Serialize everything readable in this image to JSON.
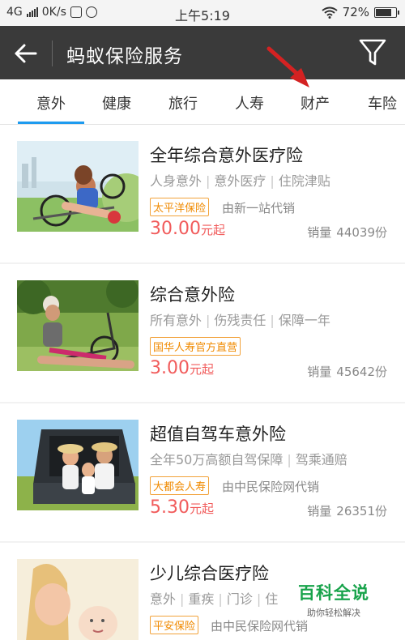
{
  "status": {
    "network": "4G",
    "speed": "0K/s",
    "time": "上午5:19",
    "battery": "72%"
  },
  "appbar": {
    "title": "蚂蚁保险服务"
  },
  "tabs": [
    {
      "label": "意外",
      "active": true
    },
    {
      "label": "健康"
    },
    {
      "label": "旅行"
    },
    {
      "label": "人寿"
    },
    {
      "label": "财产"
    },
    {
      "label": "车险"
    }
  ],
  "products": [
    {
      "name": "全年综合意外医疗险",
      "tags": [
        "人身意外",
        "意外医疗",
        "住院津贴"
      ],
      "insurer": "太平洋保险",
      "channel": "由新一站代销",
      "price": "30.00",
      "price_unit": "元起",
      "sales_label": "销量",
      "sales": "44039份"
    },
    {
      "name": "综合意外险",
      "tags": [
        "所有意外",
        "伤残责任",
        "保障一年"
      ],
      "insurer": "国华人寿官方直营",
      "channel": "",
      "price": "3.00",
      "price_unit": "元起",
      "sales_label": "销量",
      "sales": "45642份"
    },
    {
      "name": "超值自驾车意外险",
      "tags": [
        "全年50万高额自驾保障",
        "驾乘通赔"
      ],
      "insurer": "大都会人寿",
      "channel": "由中民保险网代销",
      "price": "5.30",
      "price_unit": "元起",
      "sales_label": "销量",
      "sales": "26351份"
    },
    {
      "name": "少儿综合医疗险",
      "tags": [
        "意外",
        "重疾",
        "门诊",
        "住"
      ],
      "insurer": "平安保险",
      "channel": "由中民保险网代销"
    }
  ],
  "watermark": {
    "title": "百科全说",
    "subtitle": "助你轻松解决"
  },
  "colors": {
    "appbar": "#3a3a3a",
    "tab_indicator": "#1e9bef",
    "price": "#f15b5b",
    "badge": "#f08a00",
    "watermark": "#18a34b"
  }
}
